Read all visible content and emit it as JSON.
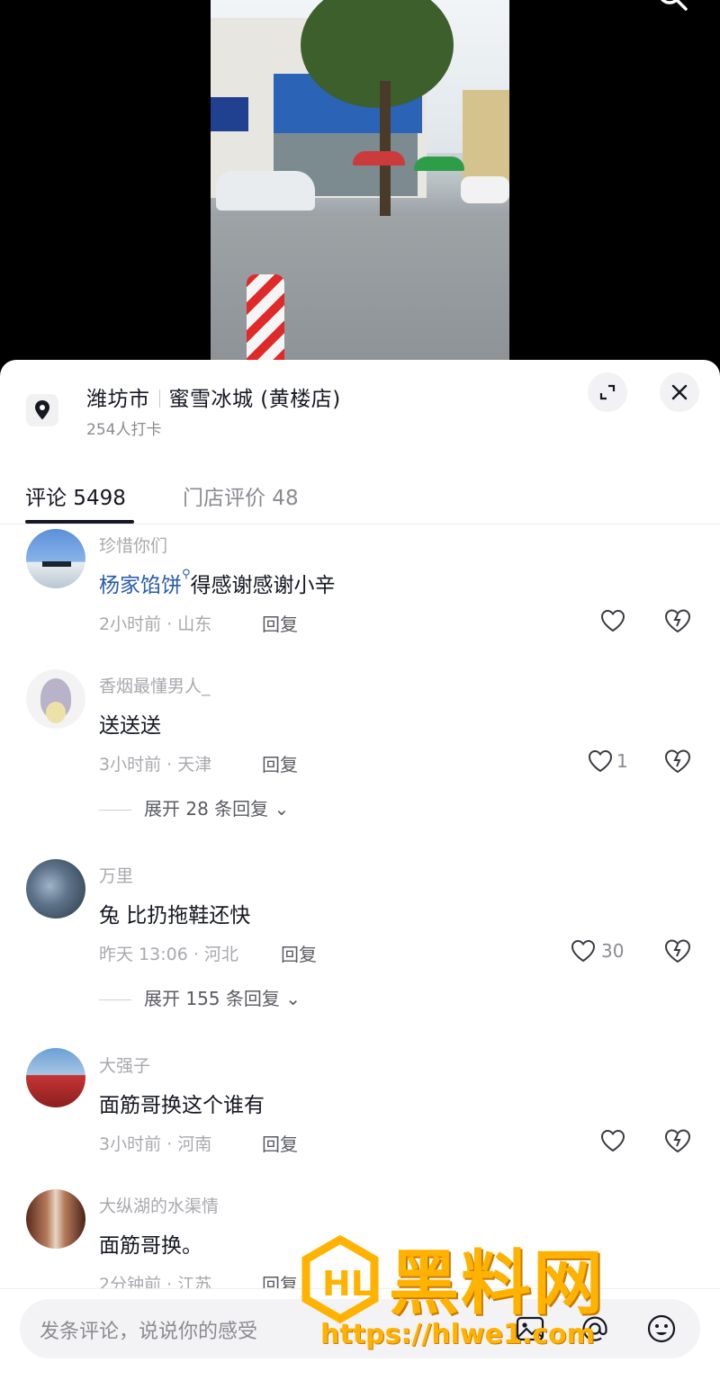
{
  "location": {
    "city": "潍坊市",
    "store": "蜜雪冰城 (黄楼店)",
    "checkins": "254人打卡"
  },
  "tabs": [
    {
      "label": "评论 5498",
      "active": true
    },
    {
      "label": "门店评价 48",
      "active": false
    }
  ],
  "comments": [
    {
      "user": "珍惜你们",
      "mention": "杨家馅饼",
      "text": "得感谢感谢小辛",
      "time_loc": "2小时前 · 山东",
      "reply": "回复",
      "likes": ""
    },
    {
      "user": "香烟最懂男人_",
      "mention": "",
      "text": "送送送",
      "time_loc": "3小时前 · 天津",
      "reply": "回复",
      "likes": "1",
      "expand": "展开 28 条回复"
    },
    {
      "user": "万里",
      "mention": "",
      "text": "兔 比扔拖鞋还快",
      "time_loc": "昨天 13:06 · 河北",
      "reply": "回复",
      "likes": "30",
      "expand": "展开 155 条回复"
    },
    {
      "user": "大强子",
      "mention": "",
      "text": "面筋哥换这个谁有",
      "time_loc": "3小时前 · 河南",
      "reply": "回复",
      "likes": ""
    },
    {
      "user": "大纵湖的水渠情",
      "mention": "",
      "text": "面筋哥换。",
      "time_loc": "2分钟前 · 江苏",
      "reply": "回复",
      "likes": ""
    }
  ],
  "input": {
    "placeholder": "发条评论，说说你的感受"
  },
  "watermark": {
    "brand": "黑料网",
    "url": "https://hlwe1.com"
  },
  "colors": {
    "text_primary": "#161823",
    "text_secondary": "#a8a9ae",
    "mention": "#2a5ca8",
    "watermark": "#ffb300"
  }
}
